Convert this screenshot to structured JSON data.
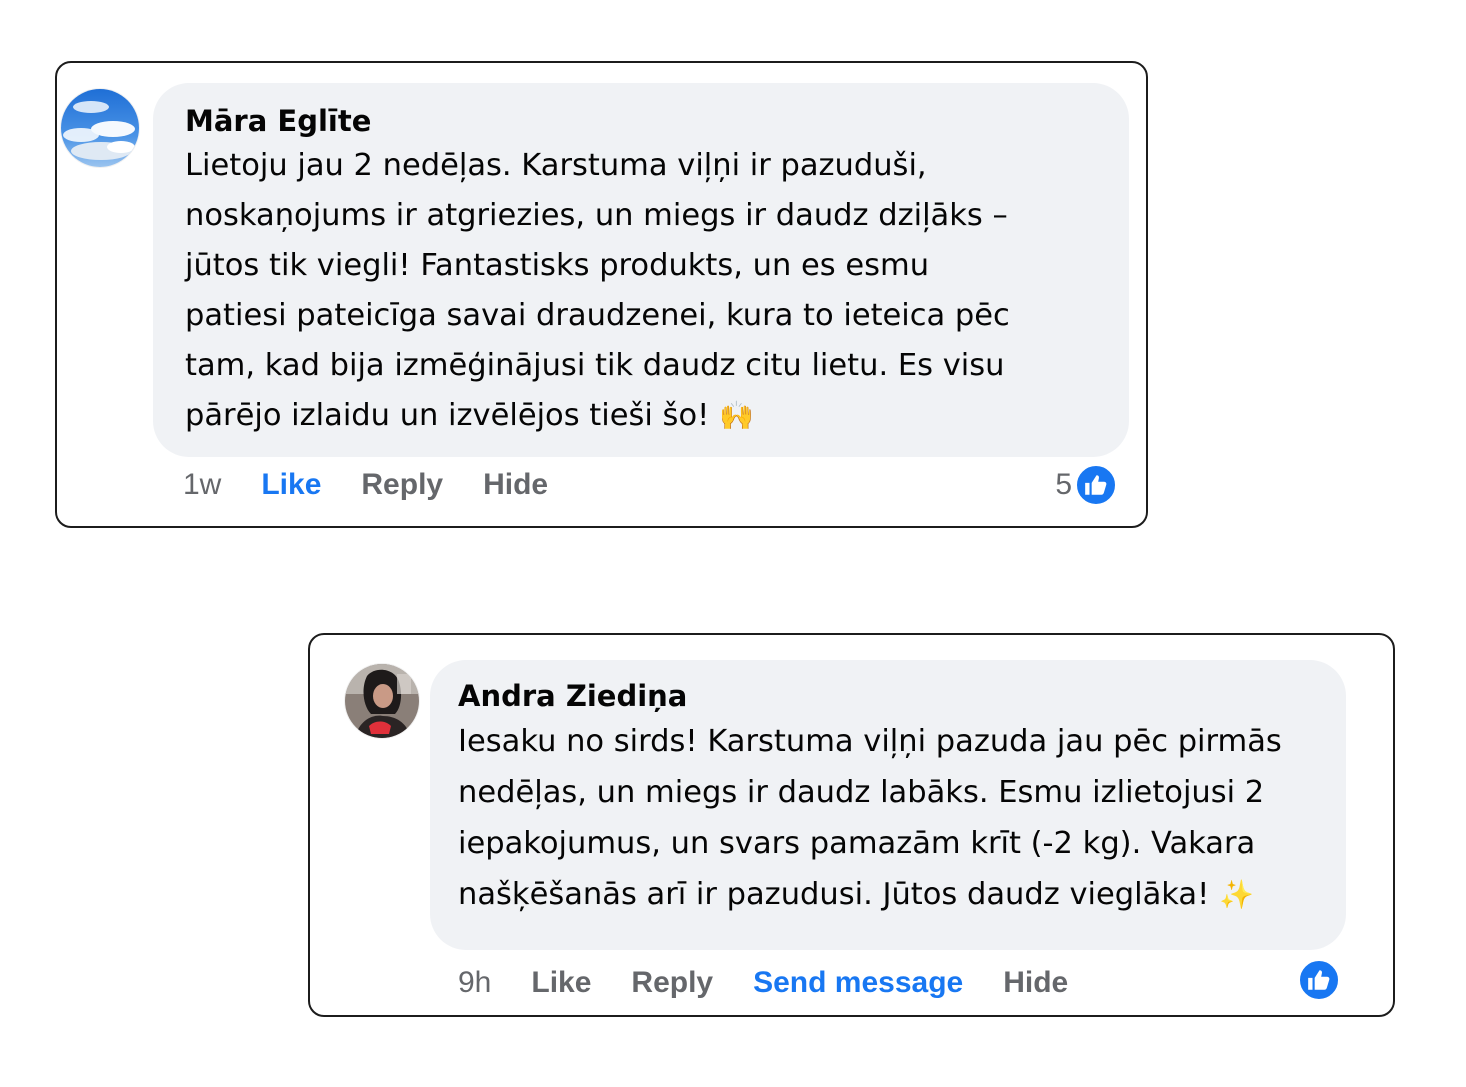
{
  "comments": [
    {
      "author": "Māra Eglīte",
      "avatar_icon": "sky-clouds-avatar",
      "lines": [
        "Lietoju jau 2 nedēļas. Karstuma viļņi ir pazuduši,",
        "noskaņojums ir atgriezies, un miegs ir daudz dziļāks –",
        "jūtos tik viegli! Fantastisks produkts, un es esmu",
        "patiesi pateicīga savai draudzenei, kura to ieteica pēc",
        "tam, kad bija izmēģinājusi tik daudz citu lietu. Es visu",
        "pārējo izlaidu un izvēlējos tieši šo!"
      ],
      "emoji": "🙌",
      "time": "1w",
      "actions": {
        "like": "Like",
        "reply": "Reply",
        "hide": "Hide"
      },
      "reaction_count": "5",
      "reaction_icon": "thumbs-up-icon"
    },
    {
      "author": "Andra Ziediņa",
      "avatar_icon": "woman-portrait-avatar",
      "lines": [
        "Iesaku no sirds! Karstuma viļņi pazuda jau pēc pirmās",
        "nedēļas, un miegs ir daudz labāks. Esmu izlietojusi 2",
        "iepakojumus, un svars pamazām krīt (-2 kg). Vakara",
        "našķēšanās arī ir pazudusi. Jūtos daudz vieglāka!"
      ],
      "emoji": "✨",
      "time": "9h",
      "actions": {
        "like": "Like",
        "reply": "Reply",
        "send_message": "Send message",
        "hide": "Hide"
      },
      "reaction_icon": "thumbs-up-icon"
    }
  ],
  "colors": {
    "link_blue": "#1877f2",
    "muted_gray": "#65676b",
    "bubble_bg": "#f0f2f5"
  }
}
